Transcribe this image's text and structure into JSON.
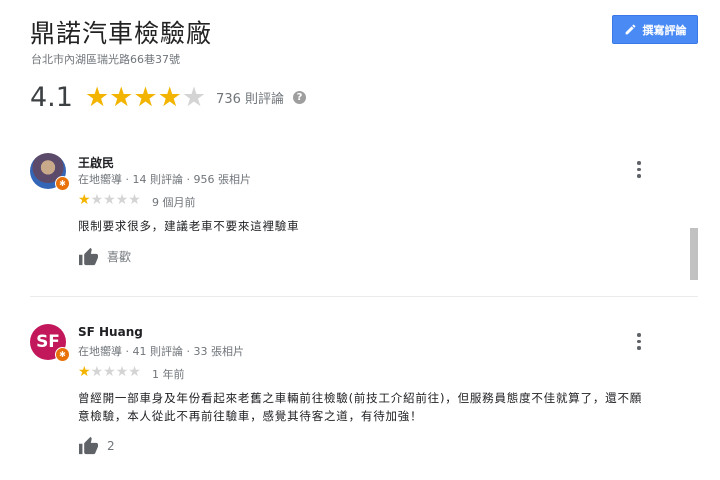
{
  "place": {
    "title": "鼎諾汽車檢驗廠",
    "address": "台北市內湖區瑞光路66巷37號",
    "rating": "4.1",
    "stars_filled": 4,
    "review_count_label": "736 則評論",
    "write_review_label": "撰寫評論"
  },
  "reviews": [
    {
      "name": "王啟民",
      "meta": "在地嚮導 · 14 則評論 · 956 張相片",
      "stars": 1,
      "time": "9 個月前",
      "text": "限制要求很多，建議老車不要來這裡驗車",
      "like_label": "喜歡"
    },
    {
      "name": "SF Huang",
      "avatar_initials": "SF",
      "meta": "在地嚮導 · 41 則評論 · 33 張相片",
      "stars": 1,
      "time": "1 年前",
      "text_line1": "曾經開一部車身及年份看起來老舊之車輛前往檢驗(前技工介紹前往)，但服務員態度不佳就算了，還不願",
      "text_line2": "意檢驗，本人從此不再前往驗車，感覺其待客之道，有待加強！",
      "like_count": "2"
    }
  ],
  "colors": {
    "accent": "#4a8af4",
    "star": "#f3b400",
    "avatar2": "#c2185b",
    "badge": "#e8710a"
  }
}
